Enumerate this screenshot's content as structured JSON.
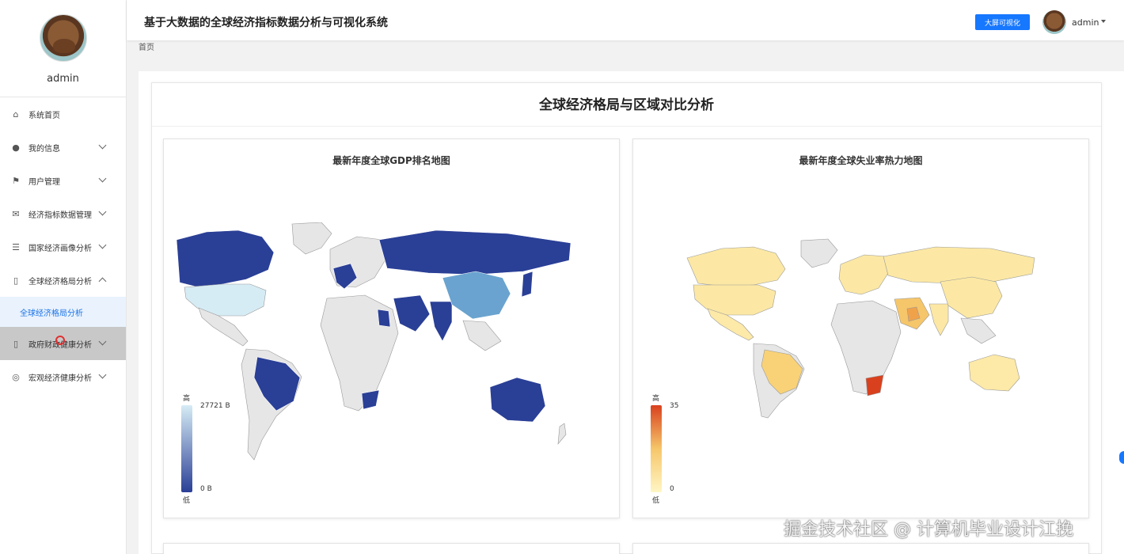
{
  "sidebar": {
    "username": "admin",
    "items": [
      {
        "label": "系统首页",
        "icon": "home-icon"
      },
      {
        "label": "我的信息",
        "icon": "user-icon"
      },
      {
        "label": "用户管理",
        "icon": "flag-icon"
      },
      {
        "label": "经济指标数据管理",
        "icon": "mail-icon"
      },
      {
        "label": "国家经济画像分析",
        "icon": "sliders-icon"
      },
      {
        "label": "全球经济格局分析",
        "icon": "microphone-icon"
      },
      {
        "label": "政府财政健康分析",
        "icon": "microphone-icon"
      },
      {
        "label": "宏观经济健康分析",
        "icon": "circle-icon"
      }
    ],
    "active_sub": "全球经济格局分析"
  },
  "header": {
    "title": "基于大数据的全球经济指标数据分析与可视化系统",
    "big_screen_button": "大屏可视化",
    "user": "admin"
  },
  "breadcrumb": "首页",
  "panel": {
    "title": "全球经济格局与区域对比分析"
  },
  "gdp_map": {
    "title": "最新年度全球GDP排名地图",
    "legend_high": "高",
    "legend_low": "低",
    "max_label": "27721 B",
    "min_label": "0 B",
    "colors": {
      "high": "#d6ecf5",
      "low": "#2a3f96",
      "nodata": "#e6e6e6"
    }
  },
  "unemployment_map": {
    "title": "最新年度全球失业率热力地图",
    "legend_high": "高",
    "legend_low": "低",
    "max_label": "35",
    "min_label": "0",
    "colors": {
      "high": "#d9411e",
      "low": "#fff6c4",
      "nodata": "#e6e6e6"
    }
  },
  "watermark": "掘金技术社区 @ 计算机毕业设计江挽"
}
